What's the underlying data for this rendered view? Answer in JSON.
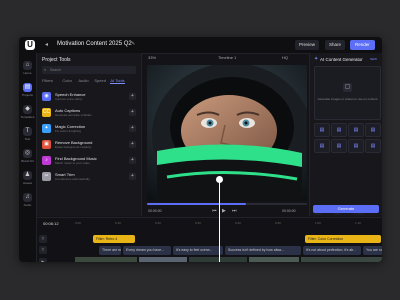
{
  "header": {
    "logo": "U",
    "project_title": "Motivation Content 2025 Q2",
    "preview_label": "Preview",
    "share_label": "Share",
    "render_label": "Render"
  },
  "leftnav": [
    {
      "icon": "home-icon",
      "glyph": "⌂",
      "label": "Home",
      "active": false
    },
    {
      "icon": "folder-icon",
      "glyph": "▤",
      "label": "Projects",
      "active": true
    },
    {
      "icon": "templates-icon",
      "glyph": "◆",
      "label": "Templates",
      "active": false
    },
    {
      "icon": "text-icon",
      "glyph": "T",
      "label": "Text",
      "active": false
    },
    {
      "icon": "brand-kit-icon",
      "glyph": "◎",
      "label": "Brand Kit",
      "active": false
    },
    {
      "icon": "assets-icon",
      "glyph": "♟",
      "label": "Assets",
      "active": false
    },
    {
      "icon": "audio-icon",
      "glyph": "♫",
      "label": "Audio",
      "active": false
    }
  ],
  "tools": {
    "title": "Project Tools",
    "search_placeholder": "Search",
    "tabs": [
      "Filters",
      "Color",
      "Audio",
      "Speed",
      "AI Tools"
    ],
    "active_tab": 4,
    "items": [
      {
        "name": "Speech Enhance",
        "desc": "Improve voice clarity",
        "color": "#5b6ef5",
        "glyph": "◉"
      },
      {
        "name": "Auto Captions",
        "desc": "Generate accurate subtitles",
        "color": "#e8b416",
        "glyph": "CC"
      },
      {
        "name": "Magic Correction",
        "desc": "Fix colors & lighting",
        "color": "#3aa0ff",
        "glyph": "✦"
      },
      {
        "name": "Remove Background",
        "desc": "Erase background instantly",
        "color": "#e0503a",
        "glyph": "▣"
      },
      {
        "name": "Find Background Music",
        "desc": "Match music to your video",
        "color": "#c13ad8",
        "glyph": "♪"
      },
      {
        "name": "Smart Trim",
        "desc": "Cut silences automatically",
        "color": "#9b9ba5",
        "glyph": "✂"
      }
    ]
  },
  "preview": {
    "zoom": "33%",
    "timeline_label": "Timeline 1",
    "quality": "HQ",
    "current_time": "00:00:00",
    "total_time": "00:00:00",
    "progress": 0.62
  },
  "ai_panel": {
    "title": "AI Content Generator",
    "badge": "NEW",
    "hint": "Generate images or videos to use on content",
    "stats": [
      "50",
      "2",
      "100"
    ],
    "generate_label": "Generate"
  },
  "timeline": {
    "timecode": "00:06:12",
    "ruler_ticks": [
      "0:00",
      "0:10",
      "0:20",
      "0:30",
      "0:40",
      "0:50",
      "1:00",
      "1:10"
    ],
    "filter_clips": [
      "Filter: Retro 4",
      "Filter: Color Correction"
    ],
    "text_clips": [
      "There are m...",
      "Every dream you have...",
      "It's easy to feel overw...",
      "Success isn't defined by how alwa...",
      "It's not about perfection; it's ab...",
      "You are not alone in..."
    ]
  }
}
